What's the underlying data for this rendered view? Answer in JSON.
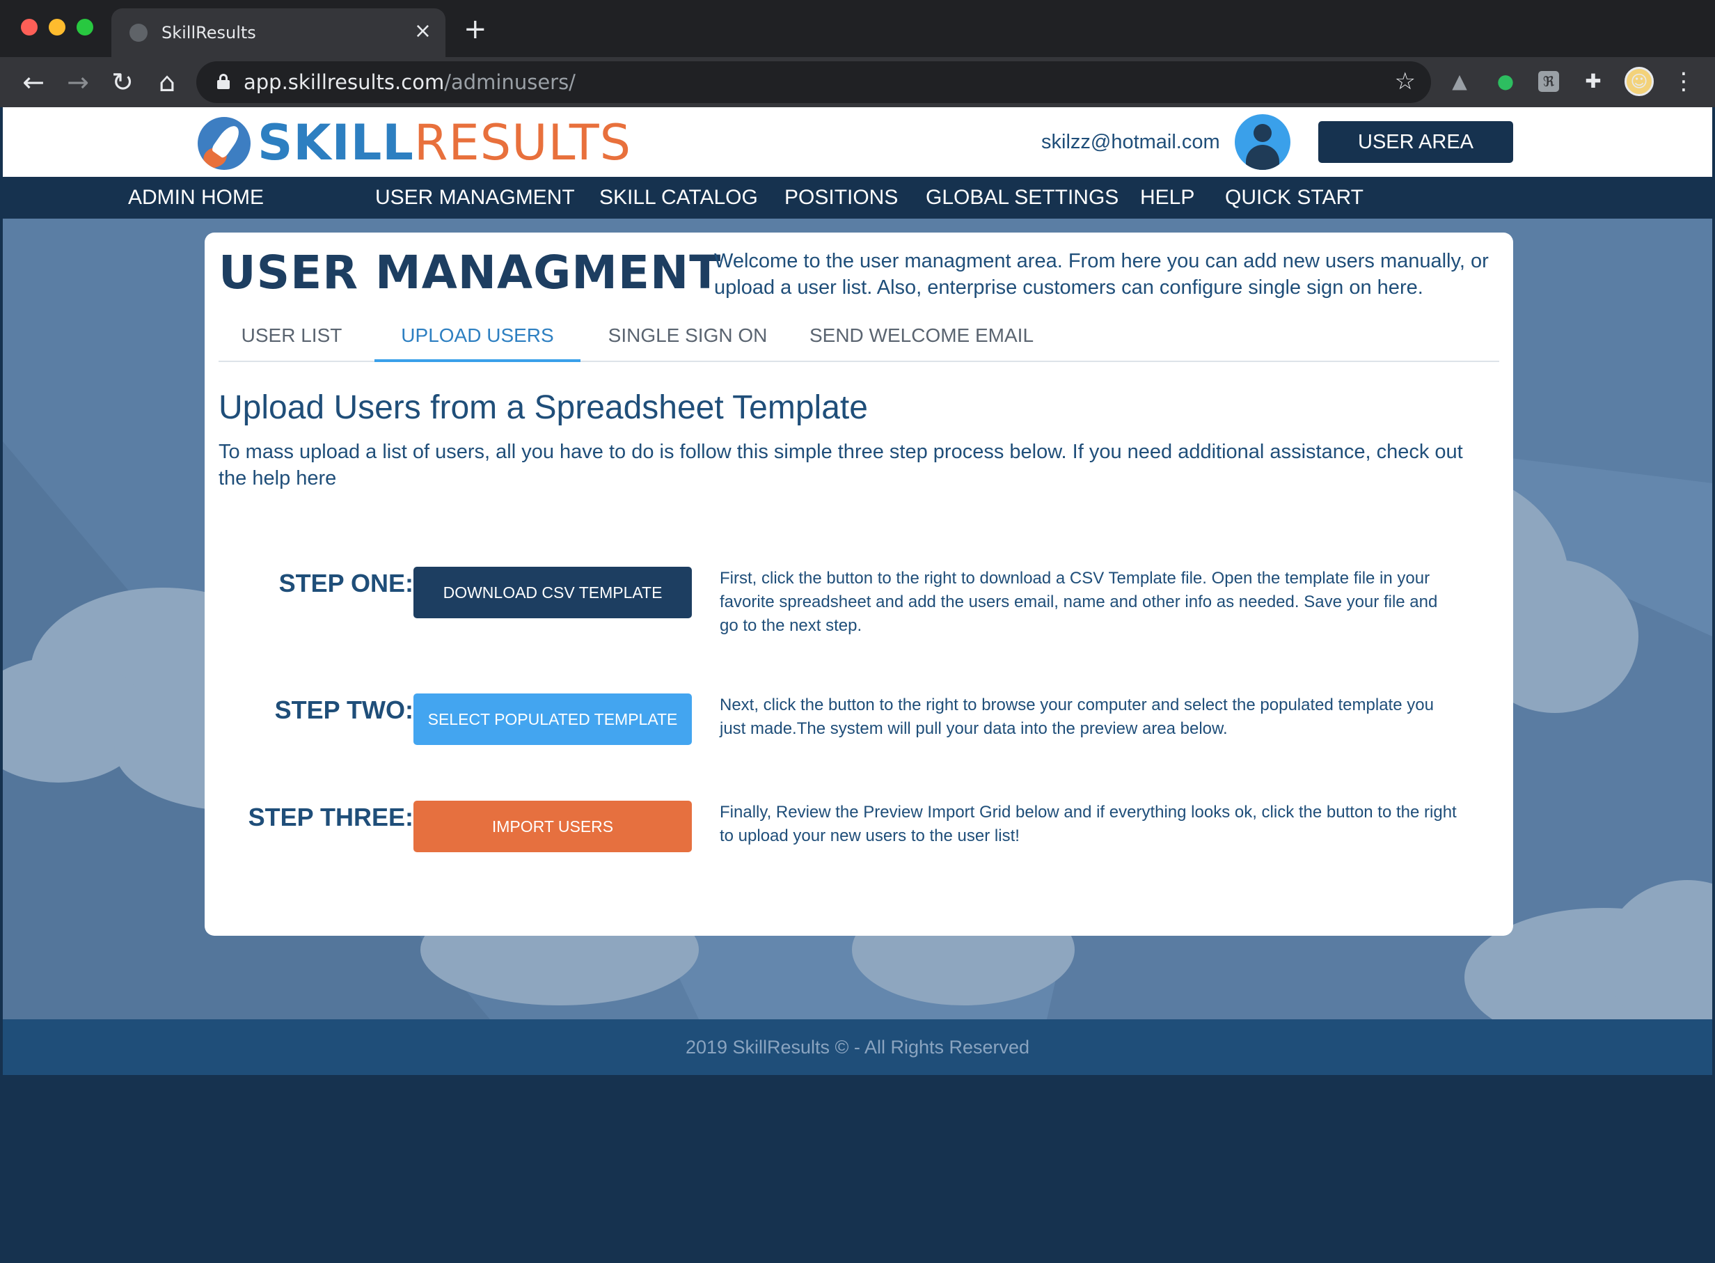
{
  "browser": {
    "tab_title": "SkillResults",
    "tab_close": "×",
    "new_tab": "+",
    "url_host": "app.skillresults.com",
    "url_path": "/adminusers/",
    "back_glyph": "←",
    "forward_glyph": "→",
    "reload_glyph": "↻",
    "home_glyph": "⌂",
    "star_glyph": "☆",
    "menu_glyph": "⋮",
    "extensions": [
      "drive-icon",
      "evernote-icon",
      "box-icon",
      "puzzle-icon",
      "profile-avatar"
    ]
  },
  "header": {
    "logo_skill": "SKILL",
    "logo_results": "RESULTS",
    "email": "skilzz@hotmail.com",
    "user_area_button": "USER AREA"
  },
  "nav": {
    "items": [
      "ADMIN HOME",
      "USER MANAGMENT",
      "SKILL CATALOG",
      "POSITIONS",
      "GLOBAL SETTINGS",
      "HELP",
      "QUICK START"
    ]
  },
  "card": {
    "title": "USER MANAGMENT",
    "intro": "Welcome to the user managment area. From here you can add new users manually, or upload a user list. Also, enterprise customers can configure single sign on here.",
    "tabs": [
      {
        "label": "USER LIST",
        "active": false
      },
      {
        "label": "UPLOAD USERS",
        "active": true
      },
      {
        "label": "SINGLE SIGN ON",
        "active": false
      },
      {
        "label": "SEND WELCOME EMAIL",
        "active": false
      }
    ],
    "section_title": "Upload Users from a Spreadsheet Template",
    "section_desc": "To mass upload a list of users, all you have to do is follow this simple three step process below. If you need additional assistance, check out the help here",
    "steps": [
      {
        "label": "STEP ONE:",
        "button": "DOWNLOAD CSV TEMPLATE",
        "description": "First, click the button to the right to download a CSV Template file. Open the template file in your favorite spreadsheet and add the users email, name and other info as needed. Save your file and go to the next step."
      },
      {
        "label": "STEP TWO:",
        "button": "SELECT POPULATED TEMPLATE",
        "description": "Next, click the button to the right to browse your computer and select the populated template you just made.The system will pull your data into the preview area below."
      },
      {
        "label": "STEP THREE:",
        "button": "IMPORT USERS",
        "description": "Finally, Review the Preview Import Grid below and if everything looks ok, click the button to the right to upload your new users to the user list!"
      }
    ]
  },
  "footer": {
    "text": "2019 SkillResults © - All Rights Reserved"
  },
  "colors": {
    "navy": "#16324f",
    "primary_blue": "#2d7fc1",
    "light_blue": "#43a5f0",
    "orange": "#e6703f",
    "background_sky": "#5b7ea4"
  }
}
